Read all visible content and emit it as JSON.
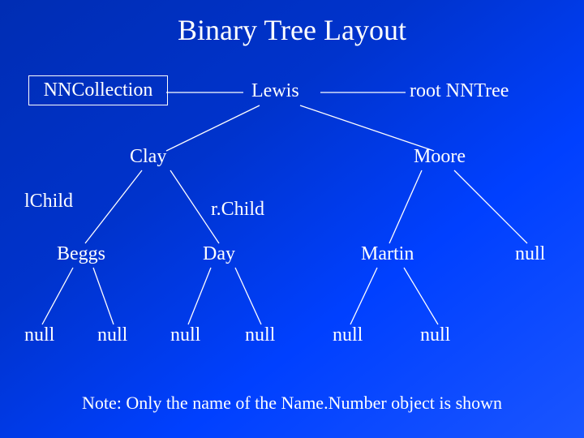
{
  "title": "Binary Tree Layout",
  "labels": {
    "collection": "NNCollection",
    "root": "root NNTree",
    "lchild": "lChild",
    "rchild": "r.Child"
  },
  "nodes": {
    "lewis": "Lewis",
    "clay": "Clay",
    "moore": "Moore",
    "beggs": "Beggs",
    "day": "Day",
    "martin": "Martin"
  },
  "leaves": {
    "null1": "null",
    "null2": "null",
    "null3": "null",
    "null4": "null",
    "null5": "null",
    "null6": "null",
    "null7": "null"
  },
  "footnote": "Note: Only the name of the Name.Number object is shown"
}
